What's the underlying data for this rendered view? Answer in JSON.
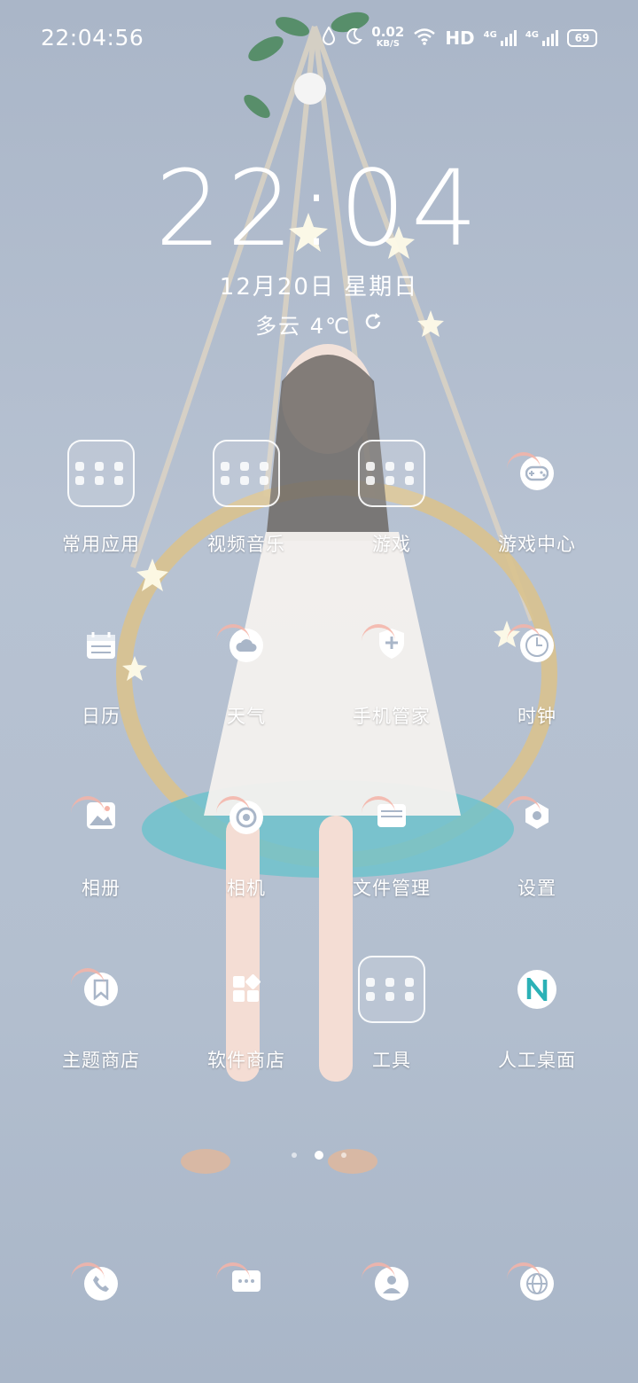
{
  "status_bar": {
    "time": "22:04:56",
    "net_speed_value": "0.02",
    "net_speed_unit": "KB/S",
    "hd_label": "HD",
    "signal1_label": "4G",
    "signal2_label": "4G",
    "battery": "69"
  },
  "clock_widget": {
    "time": "22:04",
    "date": "12月20日 星期日",
    "weather": "多云 4℃"
  },
  "apps": [
    {
      "label": "常用应用",
      "icon": "folder-icon"
    },
    {
      "label": "视频音乐",
      "icon": "folder-icon"
    },
    {
      "label": "游戏",
      "icon": "folder-icon"
    },
    {
      "label": "游戏中心",
      "icon": "gamepad-icon"
    },
    {
      "label": "日历",
      "icon": "calendar-icon"
    },
    {
      "label": "天气",
      "icon": "weather-icon"
    },
    {
      "label": "手机管家",
      "icon": "shield-icon"
    },
    {
      "label": "时钟",
      "icon": "clock-icon"
    },
    {
      "label": "相册",
      "icon": "gallery-icon"
    },
    {
      "label": "相机",
      "icon": "camera-icon"
    },
    {
      "label": "文件管理",
      "icon": "folder-file-icon"
    },
    {
      "label": "设置",
      "icon": "gear-icon"
    },
    {
      "label": "主题商店",
      "icon": "bookmark-icon"
    },
    {
      "label": "软件商店",
      "icon": "app-store-icon"
    },
    {
      "label": "工具",
      "icon": "folder-icon"
    },
    {
      "label": "人工桌面",
      "icon": "n-logo-icon"
    }
  ],
  "dock": [
    {
      "icon": "phone-icon"
    },
    {
      "icon": "messages-icon"
    },
    {
      "icon": "contacts-icon"
    },
    {
      "icon": "browser-icon"
    }
  ],
  "page_indicator": {
    "count": 3,
    "active": 2
  }
}
